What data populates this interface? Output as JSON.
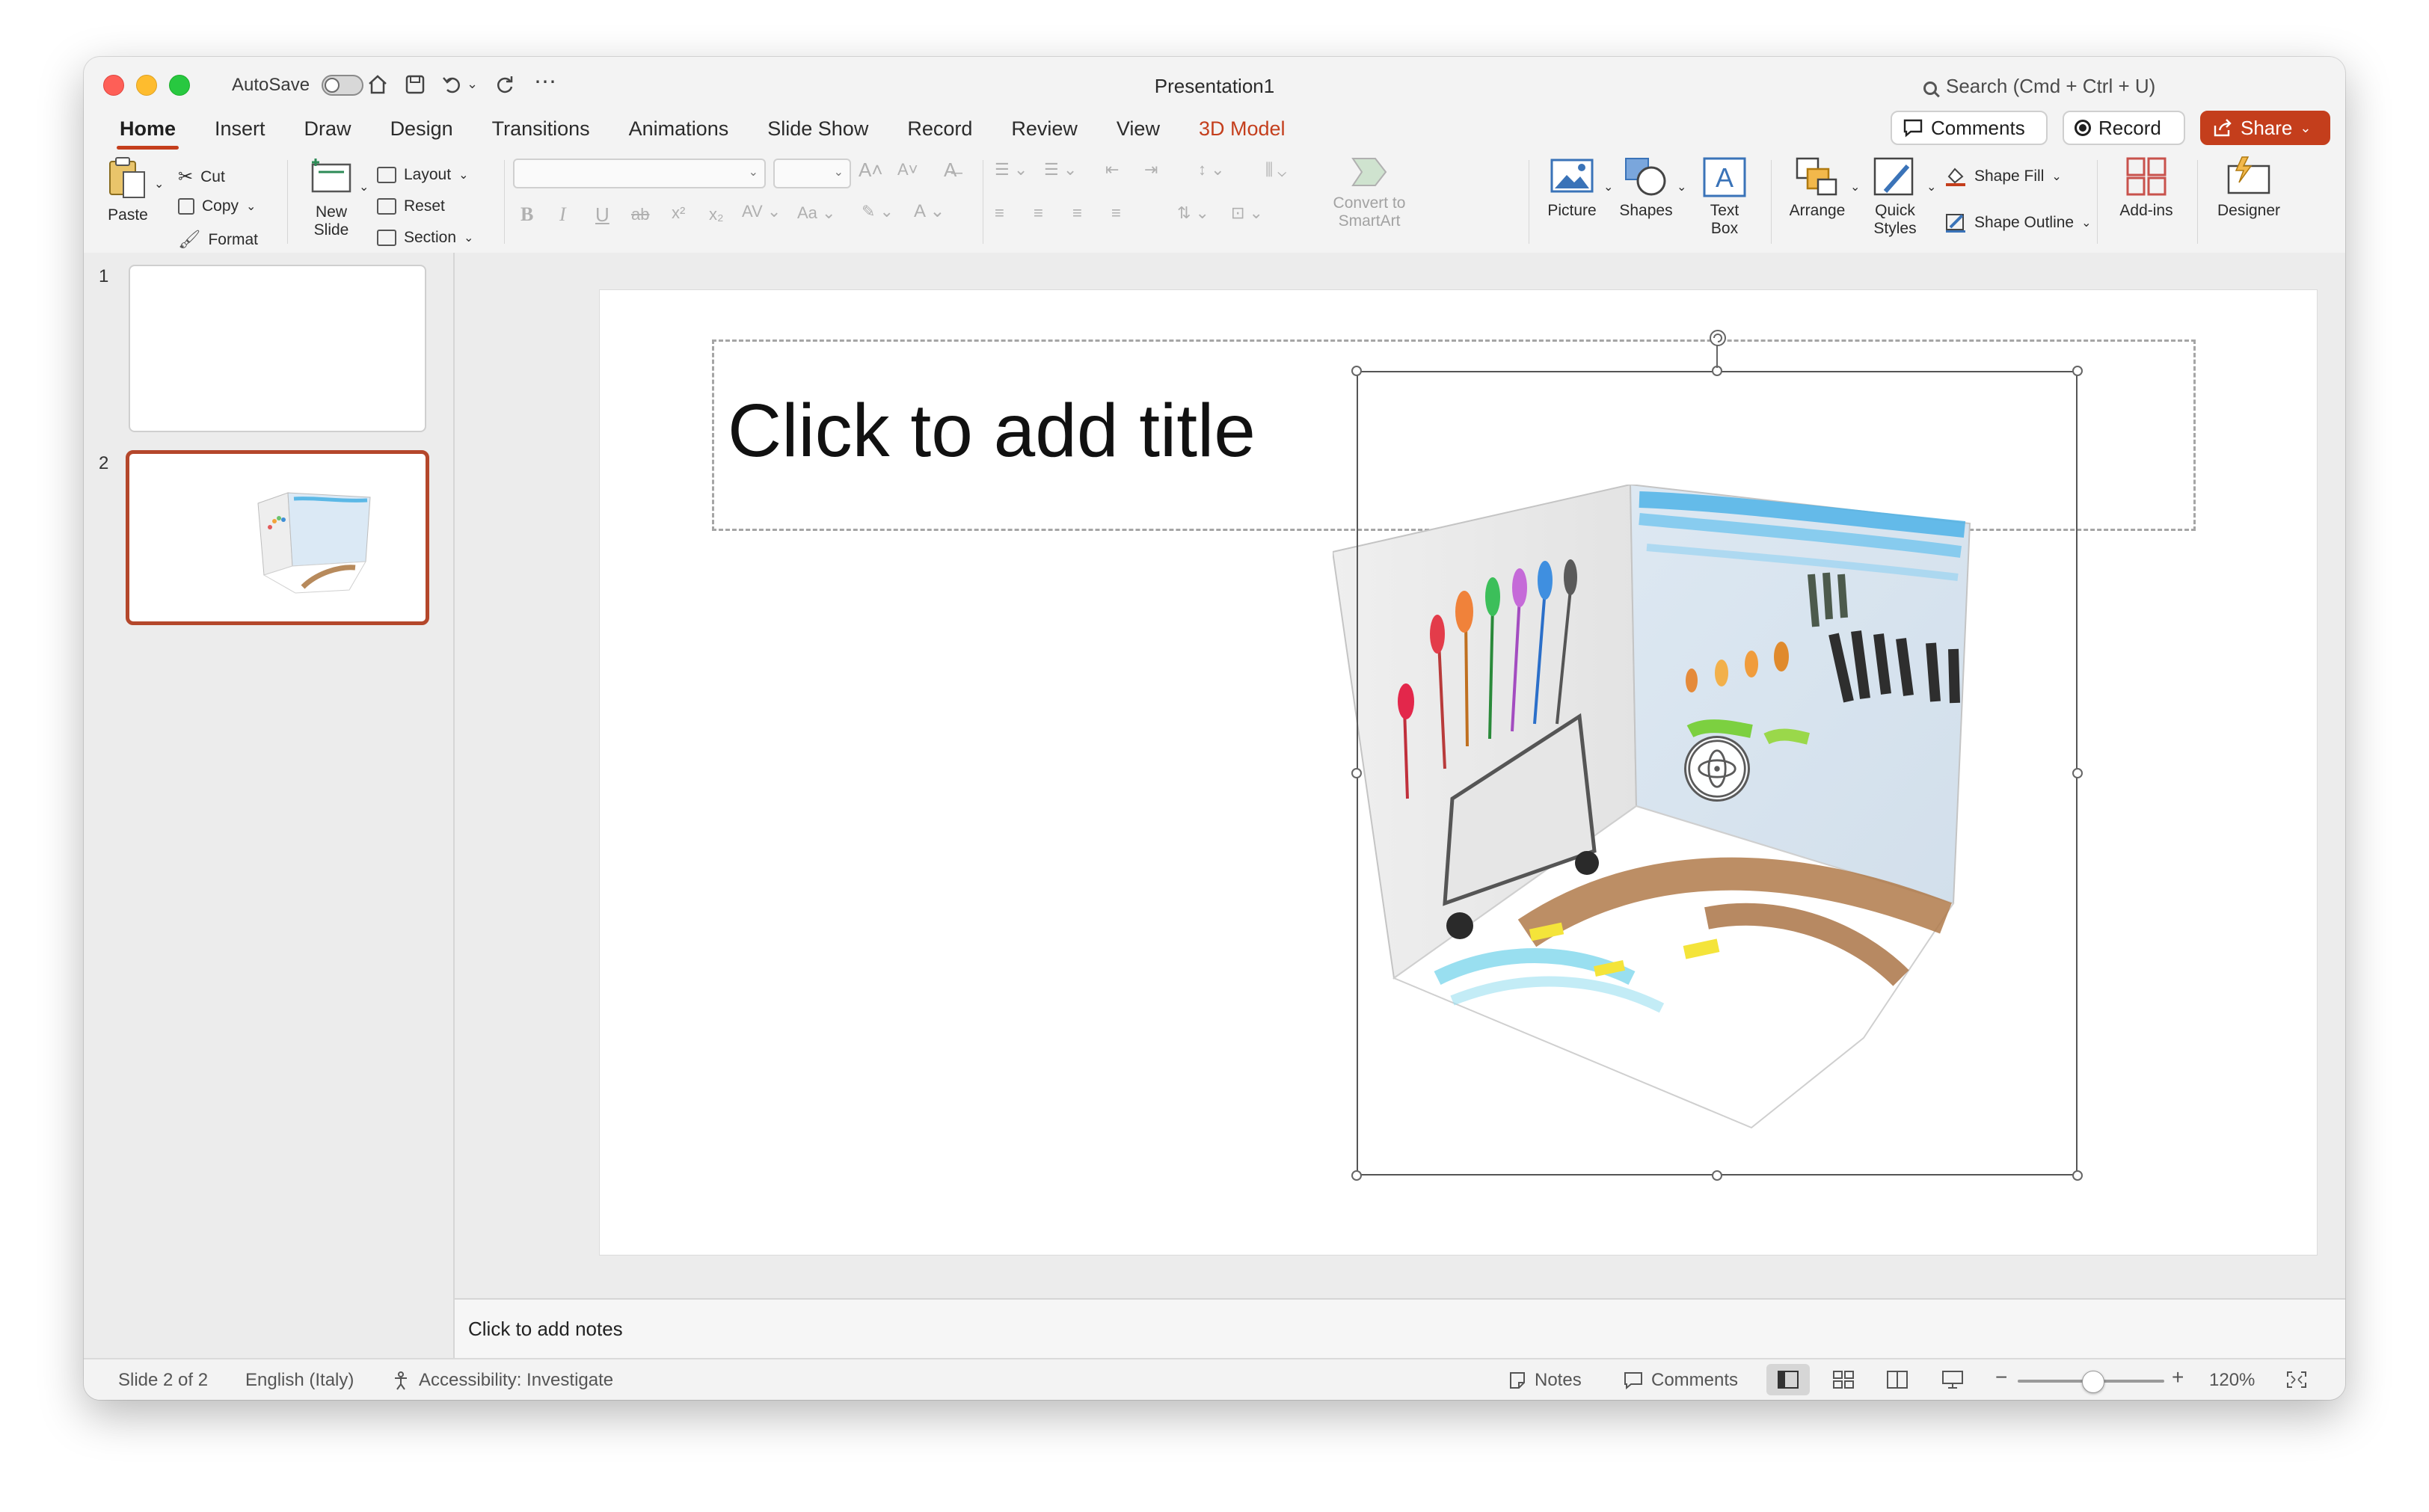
{
  "window": {
    "title": "Presentation1",
    "autosave_label": "AutoSave",
    "search_placeholder": "Search (Cmd + Ctrl + U)"
  },
  "tabs": [
    "Home",
    "Insert",
    "Draw",
    "Design",
    "Transitions",
    "Animations",
    "Slide Show",
    "Record",
    "Review",
    "View",
    "3D Model"
  ],
  "header_buttons": {
    "comments": "Comments",
    "record": "Record",
    "share": "Share"
  },
  "ribbon": {
    "paste": "Paste",
    "cut": "Cut",
    "copy": "Copy",
    "format": "Format",
    "new_slide": [
      "New",
      "Slide"
    ],
    "layout": "Layout",
    "reset": "Reset",
    "section": "Section",
    "convert_smartart": [
      "Convert to",
      "SmartArt"
    ],
    "picture": "Picture",
    "shapes": "Shapes",
    "text_box": [
      "Text",
      "Box"
    ],
    "arrange": "Arrange",
    "quick_styles": [
      "Quick",
      "Styles"
    ],
    "shape_fill": "Shape Fill",
    "shape_outline": "Shape Outline",
    "add_ins": "Add-ins",
    "designer": "Designer"
  },
  "slides_panel": {
    "numbers": [
      "1",
      "2"
    ],
    "selected": "2"
  },
  "slide": {
    "title_placeholder": "Click to add title"
  },
  "notes": {
    "placeholder": "Click to add notes"
  },
  "status": {
    "slide_info": "Slide 2 of 2",
    "language": "English (Italy)",
    "accessibility": "Accessibility: Investigate",
    "notes": "Notes",
    "comments": "Comments",
    "zoom": "120%"
  },
  "colors": {
    "accent": "#c43e1c",
    "selected_thumb_border": "#b4472b"
  }
}
